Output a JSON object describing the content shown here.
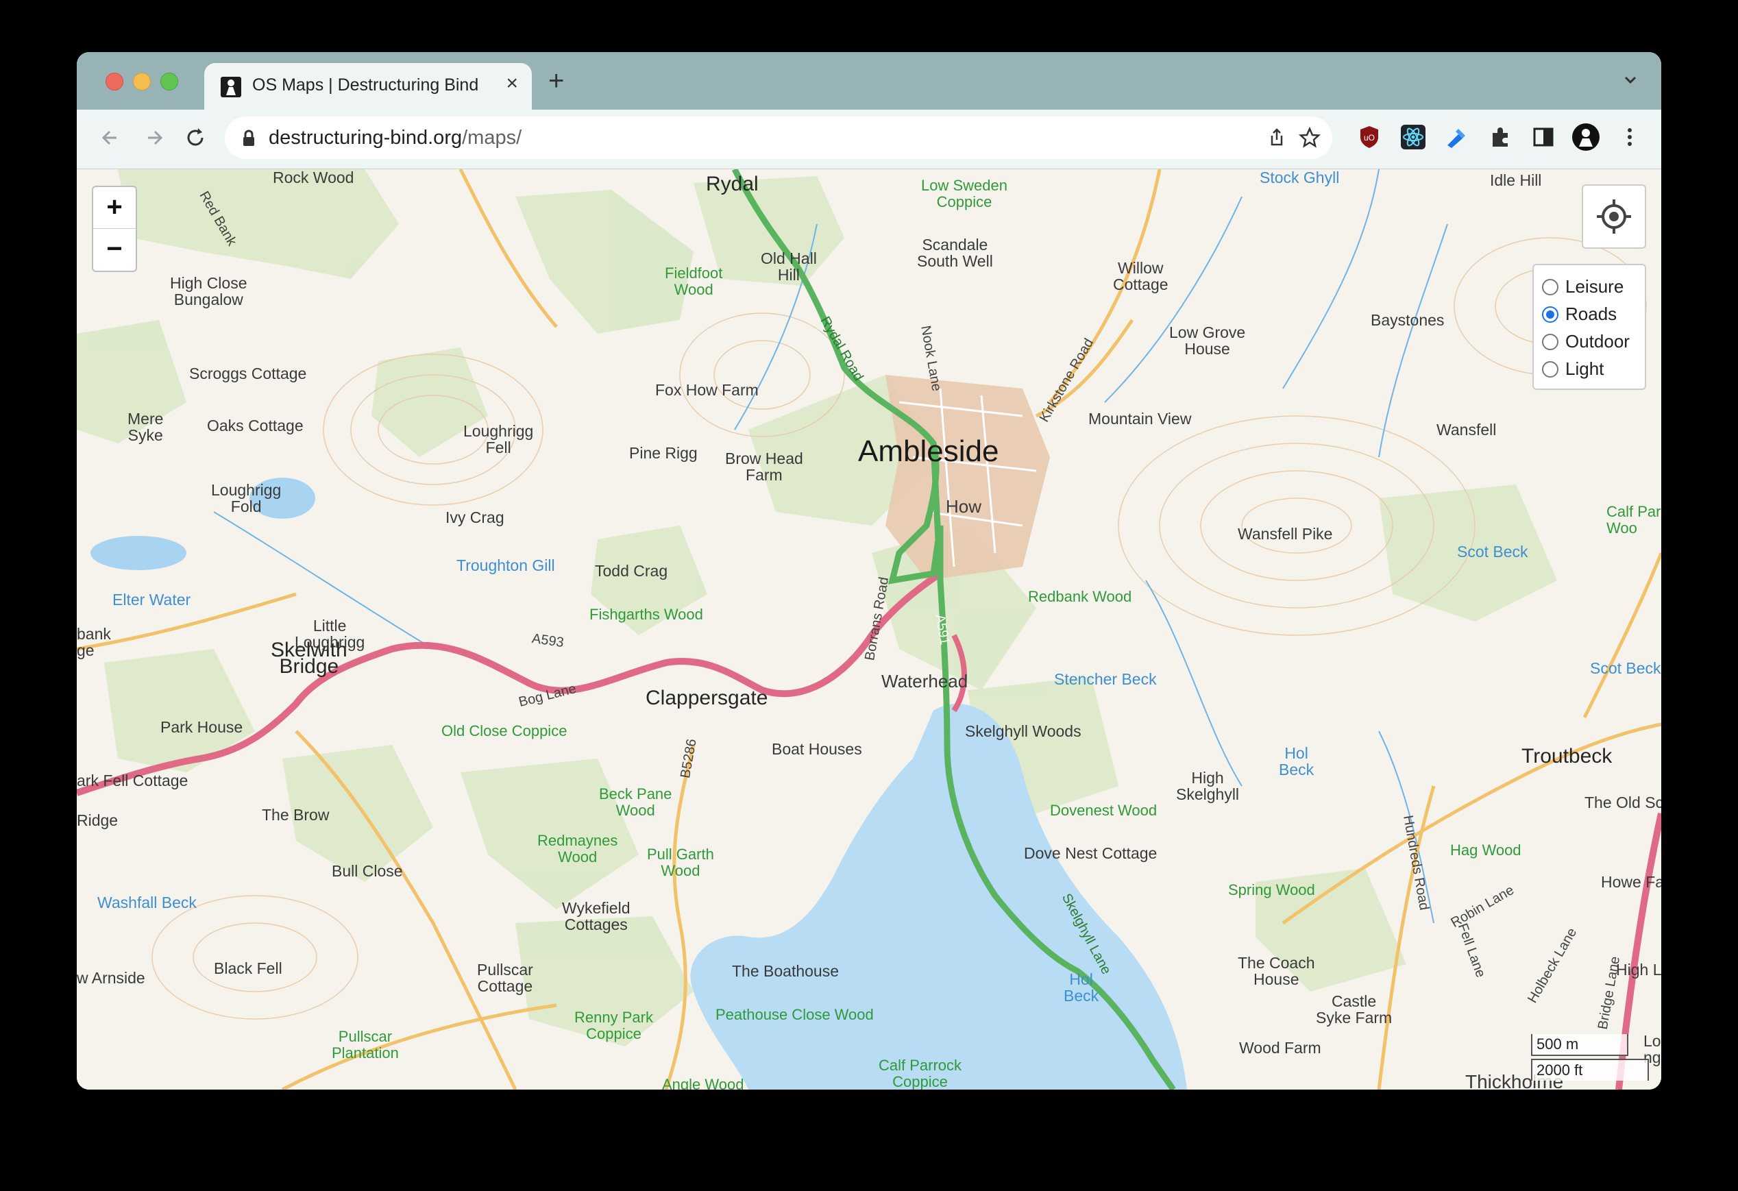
{
  "window": {
    "tab_title": "OS Maps | Destructuring Bind",
    "new_tab": "+",
    "url_host": "destructuring-bind.org",
    "url_path": "/maps/"
  },
  "map": {
    "zoom_in": "+",
    "zoom_out": "−",
    "layers": [
      {
        "label": "Leisure",
        "selected": false
      },
      {
        "label": "Roads",
        "selected": true
      },
      {
        "label": "Outdoor",
        "selected": false
      },
      {
        "label": "Light",
        "selected": false
      }
    ],
    "scale": {
      "metric": "500 m",
      "imperial": "2000 ft"
    },
    "labels": {
      "ambleside": "Ambleside",
      "rydal": "Rydal",
      "skelwith_bridge": "Skelwith\nBridge",
      "clappersgate": "Clappersgate",
      "troutbeck": "Troutbeck",
      "waterhead": "Waterhead",
      "how": "How",
      "rock_wood": "Rock Wood",
      "red_bank": "Red Bank",
      "high_close_bungalow": "High Close\nBungalow",
      "scroggs_cottage": "Scroggs Cottage",
      "mere_syke": "Mere\nSyke",
      "oaks_cottage": "Oaks Cottage",
      "loughrigg_fold": "Loughrigg\nFold",
      "loughrigg_fell": "Loughrigg\nFell",
      "elter_water": "Elter Water",
      "little_loughrigg": "Little\nLoughrigg",
      "ivy_crag": "Ivy Crag",
      "troughton_gill": "Troughton Gill",
      "todd_crag": "Todd Crag",
      "fishgarths_wood": "Fishgarths Wood",
      "pine_rigg": "Pine Rigg",
      "fox_how_farm": "Fox How Farm",
      "brow_head_farm": "Brow Head\nFarm",
      "fieldfoot_wood": "Fieldfoot\nWood",
      "old_hall_hill": "Old Hall\nHill",
      "low_sweden_coppice": "Low Sweden\nCoppice",
      "scandale_south_well": "Scandale\nSouth Well",
      "stock_ghyll": "Stock Ghyll",
      "idle_hill": "Idle Hill",
      "willow_cottage": "Willow\nCottage",
      "low_grove_house": "Low Grove\nHouse",
      "baystones": "Baystones",
      "mountain_view": "Mountain View",
      "wansfell": "Wansfell",
      "wansfell_pike": "Wansfell Pike",
      "calf_park_wood": "Calf Par\nWoo",
      "scot_beck": "Scot Beck",
      "scot_beck_2": "Scot Beck",
      "redbank_wood": "Redbank Wood",
      "stencher_beck": "Stencher Beck",
      "skelghyll_woods": "Skelghyll Woods",
      "boat_houses": "Boat Houses",
      "a593": "A593",
      "bog_lane": "Bog Lane",
      "b5286": "B5286",
      "a591": "A591",
      "rydal_road": "Rydal Road",
      "nook_lane": "Nook Lane",
      "kirkstone_road": "Kirkstone Road",
      "borrans_road": "Borrans Road",
      "skelghyll_lane": "Skelghyll Lane",
      "hundreds_road": "Hundreds Road",
      "robin_lane": "Robin Lane",
      "fell_lane": "Fell Lane",
      "holbeck_lane": "Holbeck Lane",
      "bridge_lane": "Bridge Lane",
      "bank_edge": "bank\nge",
      "park_house": "Park House",
      "ark_fell_cottage": "ark Fell Cottage",
      "ridge": "Ridge",
      "the_brow": "The Brow",
      "old_close_coppice": "Old Close Coppice",
      "beck_pane_wood": "Beck Pane\nWood",
      "redmaynes_wood": "Redmaynes\nWood",
      "pull_garth_wood": "Pull Garth\nWood",
      "bull_close": "Bull Close",
      "washfall_beck": "Washfall Beck",
      "wykefield_cottages": "Wykefield\nCottages",
      "black_fell": "Black Fell",
      "w_arnside": "w Arnside",
      "pullscar_cottage": "Pullscar\nCottage",
      "pullscar_plantation": "Pullscar\nPlantation",
      "renny_park_coppice": "Renny Park\nCoppice",
      "the_boathouse": "The Boathouse",
      "peathouse_close_wood": "Peathouse Close Wood",
      "angle_wood": "Angle Wood",
      "calf_parrock_coppice": "Calf Parrock\nCoppice",
      "hol_beck": "Hol\nBeck",
      "hol_beck_2": "Hol\nBeck",
      "dovenest_wood": "Dovenest Wood",
      "dove_nest_cottage": "Dove Nest Cottage",
      "high_skelghyll": "High\nSkelghyll",
      "spring_wood": "Spring Wood",
      "hag_wood": "Hag Wood",
      "the_coach_house": "The Coach\nHouse",
      "castle_syke_farm": "Castle\nSyke Farm",
      "wood_farm": "Wood Farm",
      "the_old_sc": "The Old Sc",
      "howe_fa": "Howe Fa",
      "high_l": "High L",
      "thickholme": "Thickholme",
      "lo_ng": "Lo\nng"
    }
  }
}
